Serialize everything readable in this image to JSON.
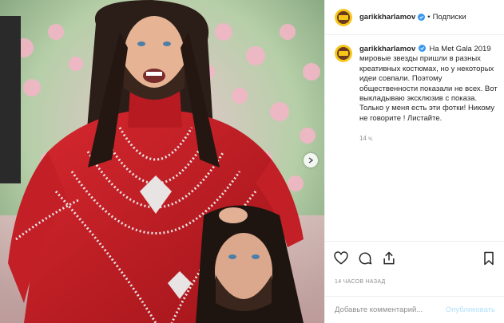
{
  "header": {
    "username": "garikkharlamov",
    "separator": "•",
    "follow_label": "Подписки"
  },
  "caption": {
    "username": "garikkharlamov",
    "text": "На Met Gala 2019 мировые звезды пришли в разных креативных костюмах, но у некоторых идеи совпали. Поэтому общественности показали не всех. Вот выкладываю эксклюзив с показа. Только у меня есть эти фотки! Никому не говорите ! Листайте.",
    "time": "14 ч."
  },
  "actions": {
    "like_icon": "heart-icon",
    "comment_icon": "comment-icon",
    "share_icon": "share-icon",
    "save_icon": "bookmark-icon"
  },
  "timestamp": "14 ЧАСОВ НАЗАД",
  "comment": {
    "placeholder": "Добавьте комментарий...",
    "publish_label": "Опубликовать"
  },
  "colors": {
    "verified": "#3897f0",
    "publish_disabled": "#b2dffc",
    "dress": "#c8202a"
  }
}
